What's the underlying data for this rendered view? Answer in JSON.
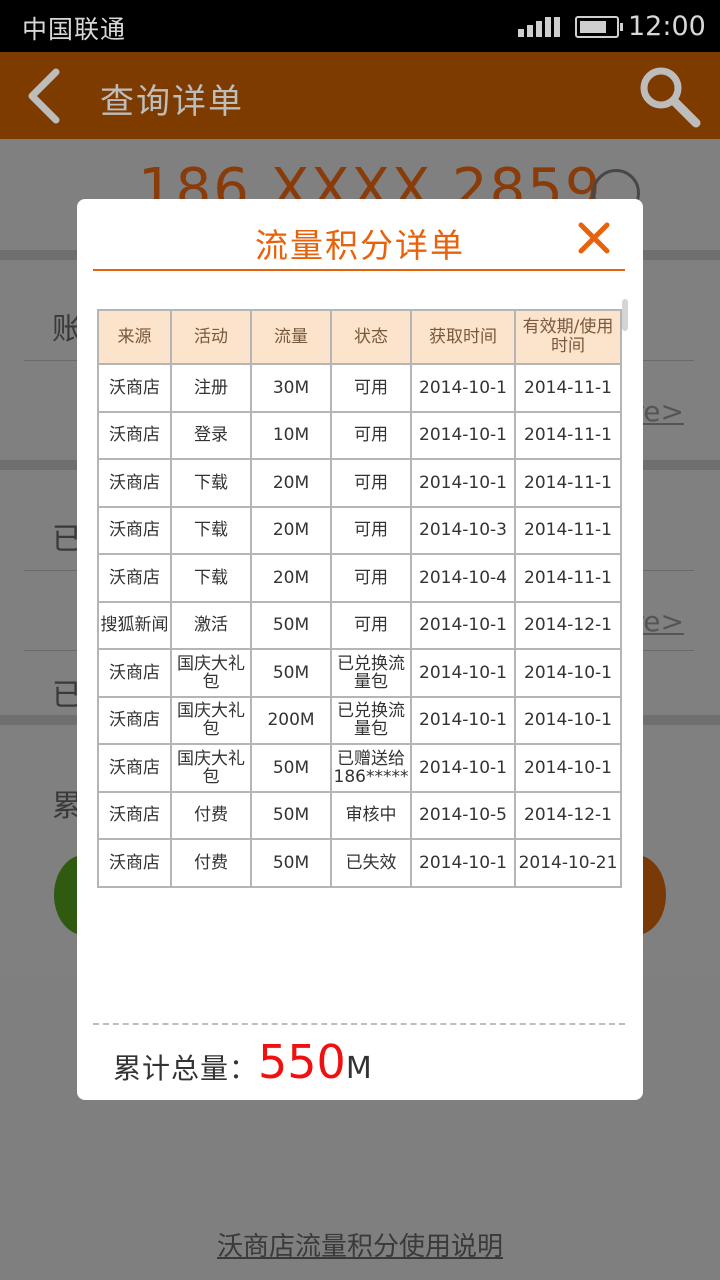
{
  "status_bar": {
    "carrier": "中国联通",
    "time": "12:00"
  },
  "nav": {
    "title": "查询详单"
  },
  "background": {
    "phone_number": "186 XXXX 2859",
    "section1_label": "账",
    "section1_link": "re>",
    "section2_label": "已",
    "section2_link": "re>",
    "section2_sub": "已",
    "section3_label": "累",
    "footer_link": "沃商店流量积分使用说明"
  },
  "modal": {
    "title": "流量积分详单",
    "columns": [
      "来源",
      "活动",
      "流量",
      "状态",
      "获取时间",
      "有效期/使用时间"
    ],
    "rows": [
      [
        "沃商店",
        "注册",
        "30M",
        "可用",
        "2014-10-1",
        "2014-11-1"
      ],
      [
        "沃商店",
        "登录",
        "10M",
        "可用",
        "2014-10-1",
        "2014-11-1"
      ],
      [
        "沃商店",
        "下载",
        "20M",
        "可用",
        "2014-10-1",
        "2014-11-1"
      ],
      [
        "沃商店",
        "下载",
        "20M",
        "可用",
        "2014-10-3",
        "2014-11-1"
      ],
      [
        "沃商店",
        "下载",
        "20M",
        "可用",
        "2014-10-4",
        "2014-11-1"
      ],
      [
        "搜狐新闻",
        "激活",
        "50M",
        "可用",
        "2014-10-1",
        "2014-12-1"
      ],
      [
        "沃商店",
        "国庆大礼包",
        "50M",
        "已兑换流量包",
        "2014-10-1",
        "2014-10-1"
      ],
      [
        "沃商店",
        "国庆大礼包",
        "200M",
        "已兑换流量包",
        "2014-10-1",
        "2014-10-1"
      ],
      [
        "沃商店",
        "国庆大礼包",
        "50M",
        "已赠送给186*****",
        "2014-10-1",
        "2014-10-1"
      ],
      [
        "沃商店",
        "付费",
        "50M",
        "审核中",
        "2014-10-5",
        "2014-12-1"
      ],
      [
        "沃商店",
        "付费",
        "50M",
        "已失效",
        "2014-10-1",
        "2014-10-21"
      ]
    ],
    "total_label": "累计总量：",
    "total_value": "550",
    "total_unit": "M"
  },
  "colors": {
    "accent": "#e8620c",
    "nav_bg": "#7d3b00",
    "total_value": "#f01010",
    "header_bg": "#fbe3cc"
  },
  "icons": {
    "back": "chevron-left-icon",
    "search": "search-icon",
    "close": "close-icon",
    "edit": "pencil-icon"
  }
}
